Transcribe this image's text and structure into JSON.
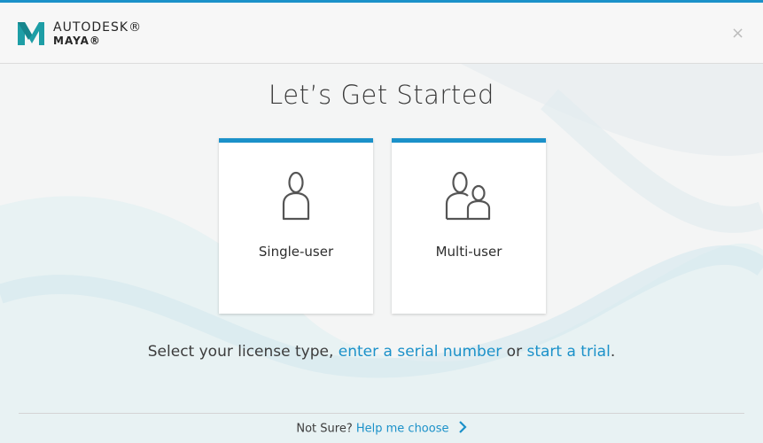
{
  "header": {
    "brand_top": "AUTODESK®",
    "brand_bottom": "MAYA®",
    "close_glyph": "×"
  },
  "main": {
    "title": "Let’s Get Started",
    "cards": [
      {
        "label": "Single-user",
        "icon": "single-user-icon"
      },
      {
        "label": "Multi-user",
        "icon": "multi-user-icon"
      }
    ],
    "license_line": {
      "prefix": "Select your license type, ",
      "serial_link": "enter a serial number",
      "middle": " or ",
      "trial_link": "start a trial",
      "suffix": "."
    }
  },
  "footer": {
    "question": "Not Sure?",
    "help_link": "Help me choose"
  },
  "colors": {
    "accent": "#1b91c9",
    "logo_teal": "#1e9ea6"
  }
}
